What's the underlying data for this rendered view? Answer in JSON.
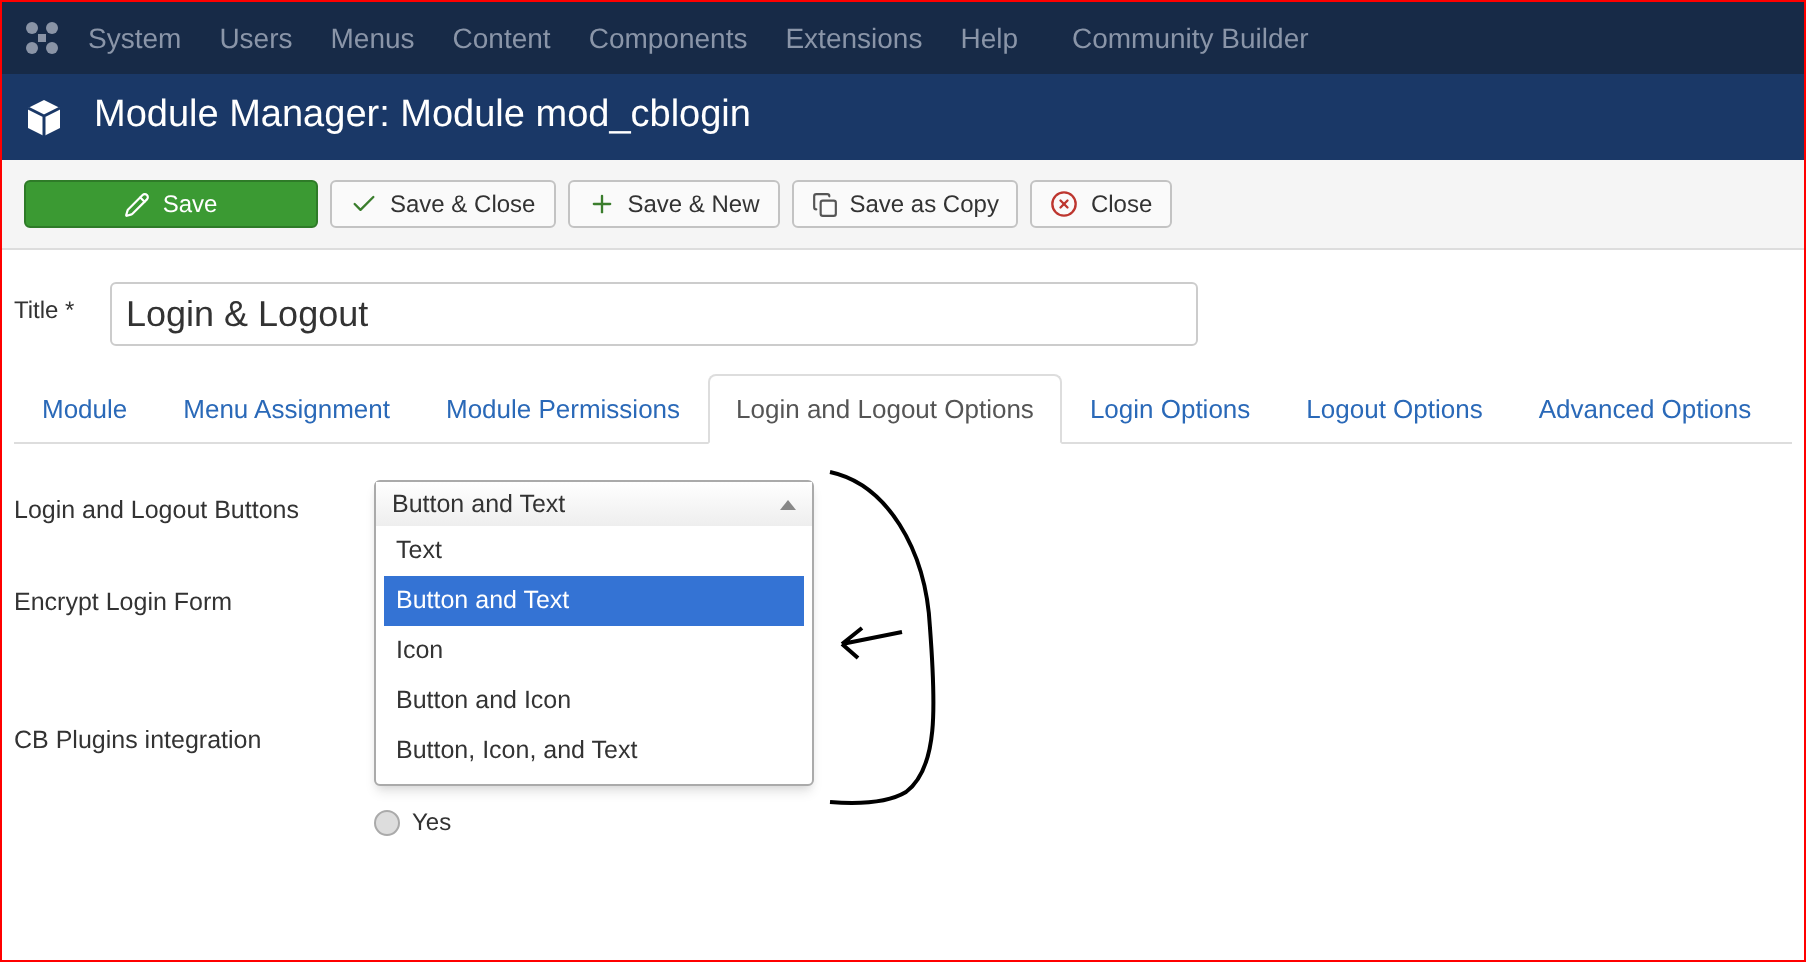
{
  "menu_bar": {
    "items": [
      "System",
      "Users",
      "Menus",
      "Content",
      "Components",
      "Extensions",
      "Help",
      "Community Builder"
    ]
  },
  "header": {
    "title": "Module Manager: Module mod_cblogin"
  },
  "toolbar": {
    "buttons": [
      {
        "label": "Save",
        "kind": "primary"
      },
      {
        "label": "Save & Close",
        "kind": "default"
      },
      {
        "label": "Save & New",
        "kind": "default"
      },
      {
        "label": "Save as Copy",
        "kind": "default"
      },
      {
        "label": "Close",
        "kind": "default"
      }
    ]
  },
  "title_field": {
    "label": "Title *",
    "value": "Login & Logout"
  },
  "tabs": [
    {
      "label": "Module",
      "selected": false
    },
    {
      "label": "Menu Assignment",
      "selected": false
    },
    {
      "label": "Module Permissions",
      "selected": false
    },
    {
      "label": "Login and Logout Options",
      "selected": true
    },
    {
      "label": "Login Options",
      "selected": false
    },
    {
      "label": "Logout Options",
      "selected": false
    },
    {
      "label": "Advanced Options",
      "selected": false
    }
  ],
  "form": {
    "rows": [
      {
        "label": "Login and Logout Buttons"
      },
      {
        "label": "Encrypt Login Form"
      },
      {
        "label": "CB Plugins integration"
      }
    ],
    "dropdown": {
      "value": "Button and Text",
      "expanded": true,
      "options": [
        {
          "label": "Text",
          "selected": false
        },
        {
          "label": "Button and Text",
          "selected": true
        },
        {
          "label": "Icon",
          "selected": false
        },
        {
          "label": "Button and Icon",
          "selected": false
        },
        {
          "label": "Button, Icon, and Text",
          "selected": false
        }
      ]
    },
    "radio": {
      "label": "Yes",
      "checked": false
    }
  }
}
